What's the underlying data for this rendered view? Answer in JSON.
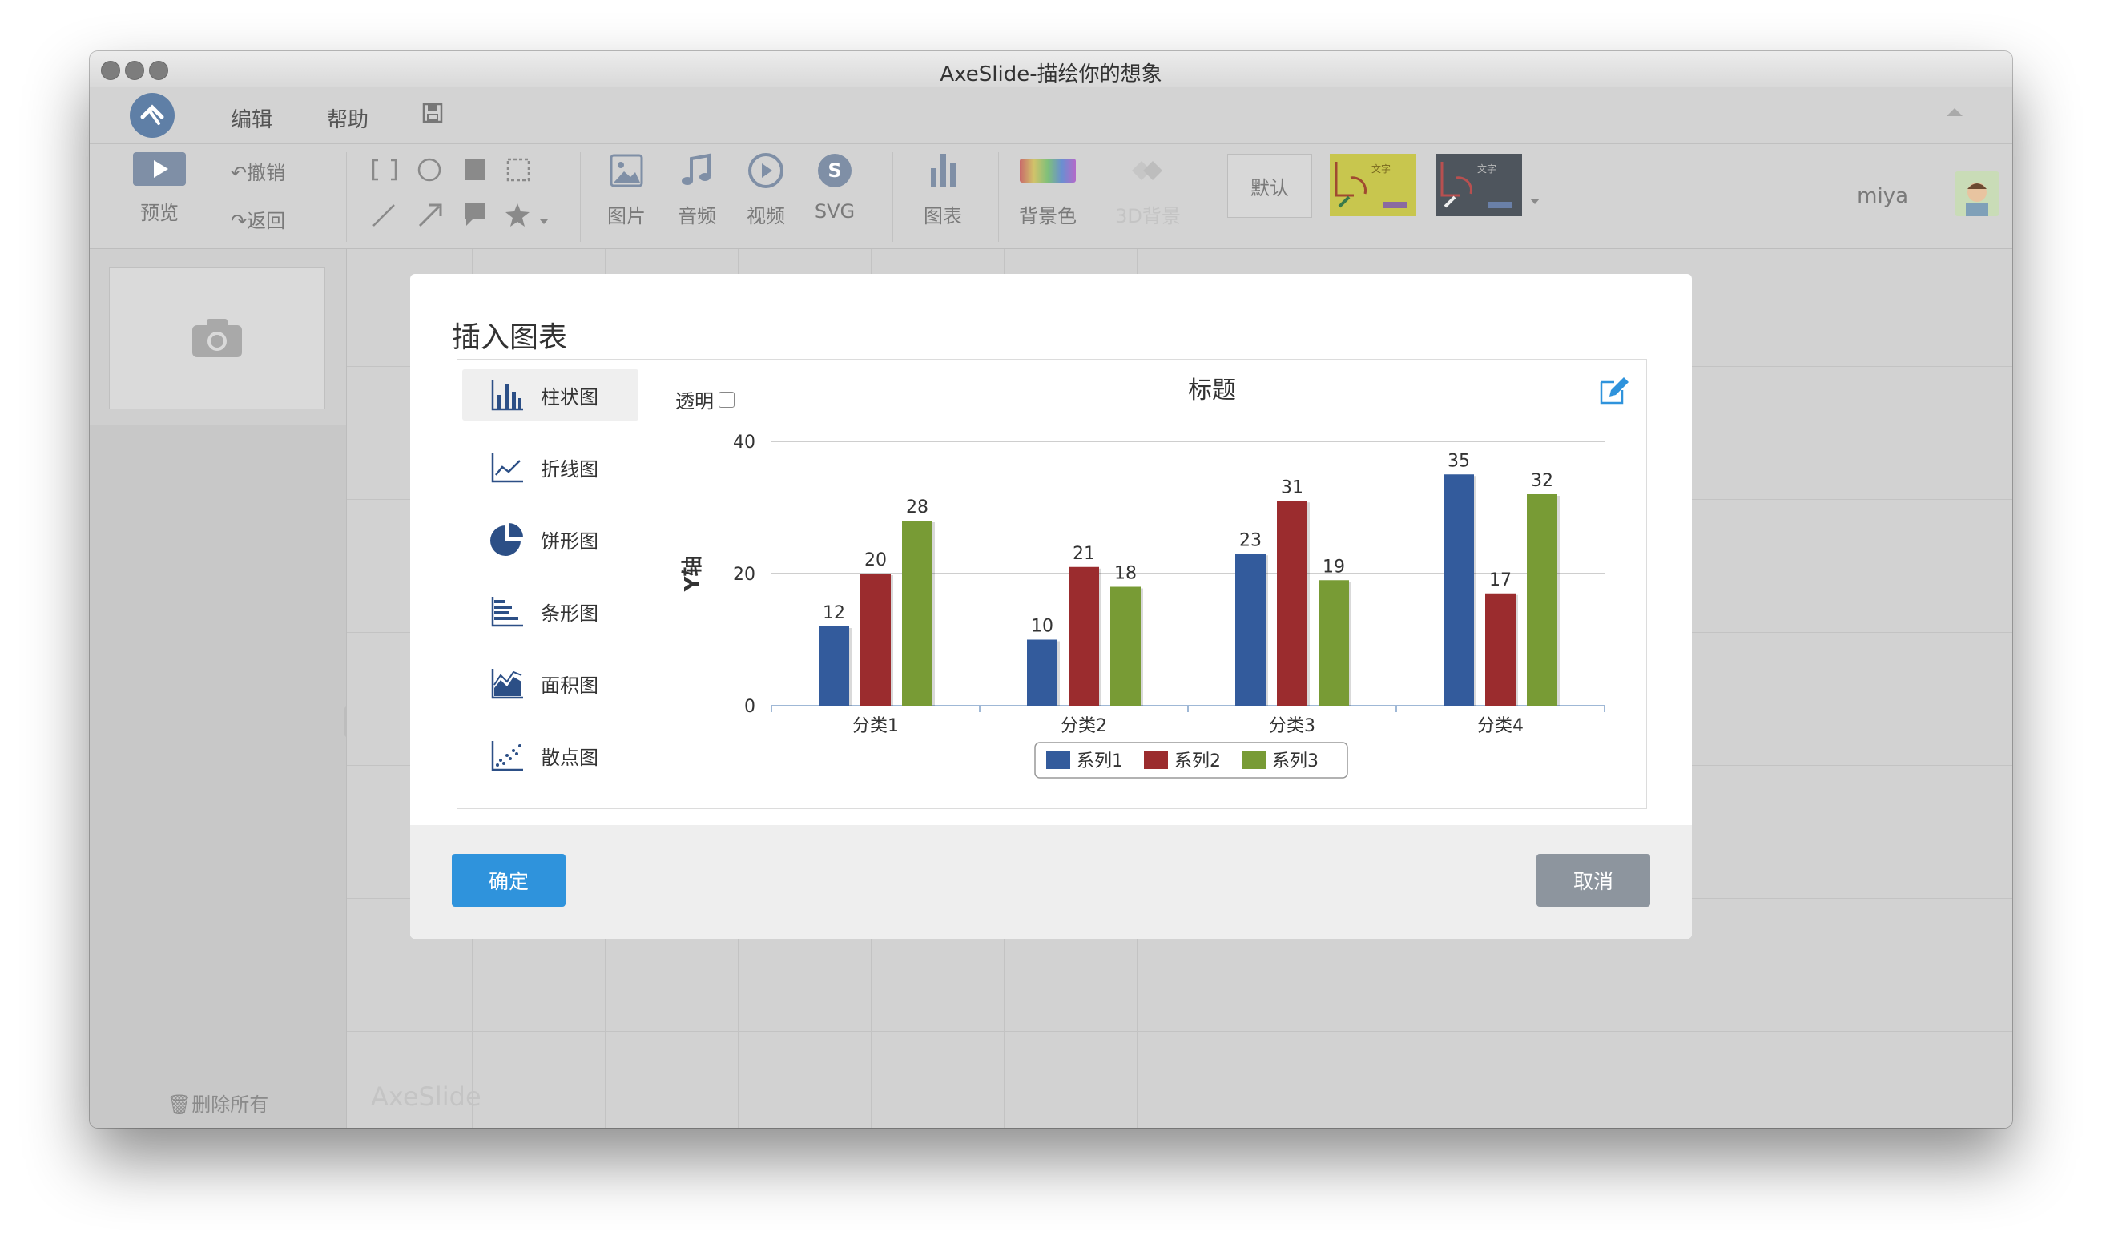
{
  "window": {
    "title": "AxeSlide-描绘你的想象"
  },
  "menu": {
    "edit": "编辑",
    "help": "帮助"
  },
  "toolbar": {
    "preview": "预览",
    "undo": "撤销",
    "redo": "返回",
    "image": "图片",
    "audio": "音频",
    "video": "视频",
    "svg": "SVG",
    "chart": "图表",
    "bg_color": "背景色",
    "bg_3d": "3D背景",
    "theme_default": "默认",
    "theme_text": "文字",
    "user": "miya"
  },
  "sidebar": {
    "delete_all": "删除所有"
  },
  "canvas": {
    "watermark": "AxeSlide"
  },
  "dialog": {
    "title": "插入图表",
    "transparent_label": "透明",
    "transparent_checked": false,
    "ok": "确定",
    "cancel": "取消",
    "chart_types": [
      {
        "label": "柱状图",
        "icon": "bar-chart-icon",
        "active": true
      },
      {
        "label": "折线图",
        "icon": "line-chart-icon",
        "active": false
      },
      {
        "label": "饼形图",
        "icon": "pie-chart-icon",
        "active": false
      },
      {
        "label": "条形图",
        "icon": "horizontal-bar-chart-icon",
        "active": false
      },
      {
        "label": "面积图",
        "icon": "area-chart-icon",
        "active": false
      },
      {
        "label": "散点图",
        "icon": "scatter-chart-icon",
        "active": false
      }
    ]
  },
  "chart_data": {
    "type": "bar",
    "title": "标题",
    "xlabel": "",
    "ylabel": "Y轴",
    "ylim": [
      0,
      40
    ],
    "yticks": [
      0,
      20,
      40
    ],
    "grid": true,
    "legend": "bottom-center",
    "categories": [
      "分类1",
      "分类2",
      "分类3",
      "分类4"
    ],
    "series": [
      {
        "name": "系列1",
        "color": "#335b9c",
        "values": [
          12,
          10,
          23,
          35
        ]
      },
      {
        "name": "系列2",
        "color": "#9b2c2e",
        "values": [
          20,
          21,
          31,
          17
        ]
      },
      {
        "name": "系列3",
        "color": "#789b35",
        "values": [
          28,
          18,
          19,
          32
        ]
      }
    ]
  },
  "colors": {
    "ok_button": "#2f93dc",
    "cancel_button": "#8d959e",
    "icon_blue": "#2c4f86"
  }
}
